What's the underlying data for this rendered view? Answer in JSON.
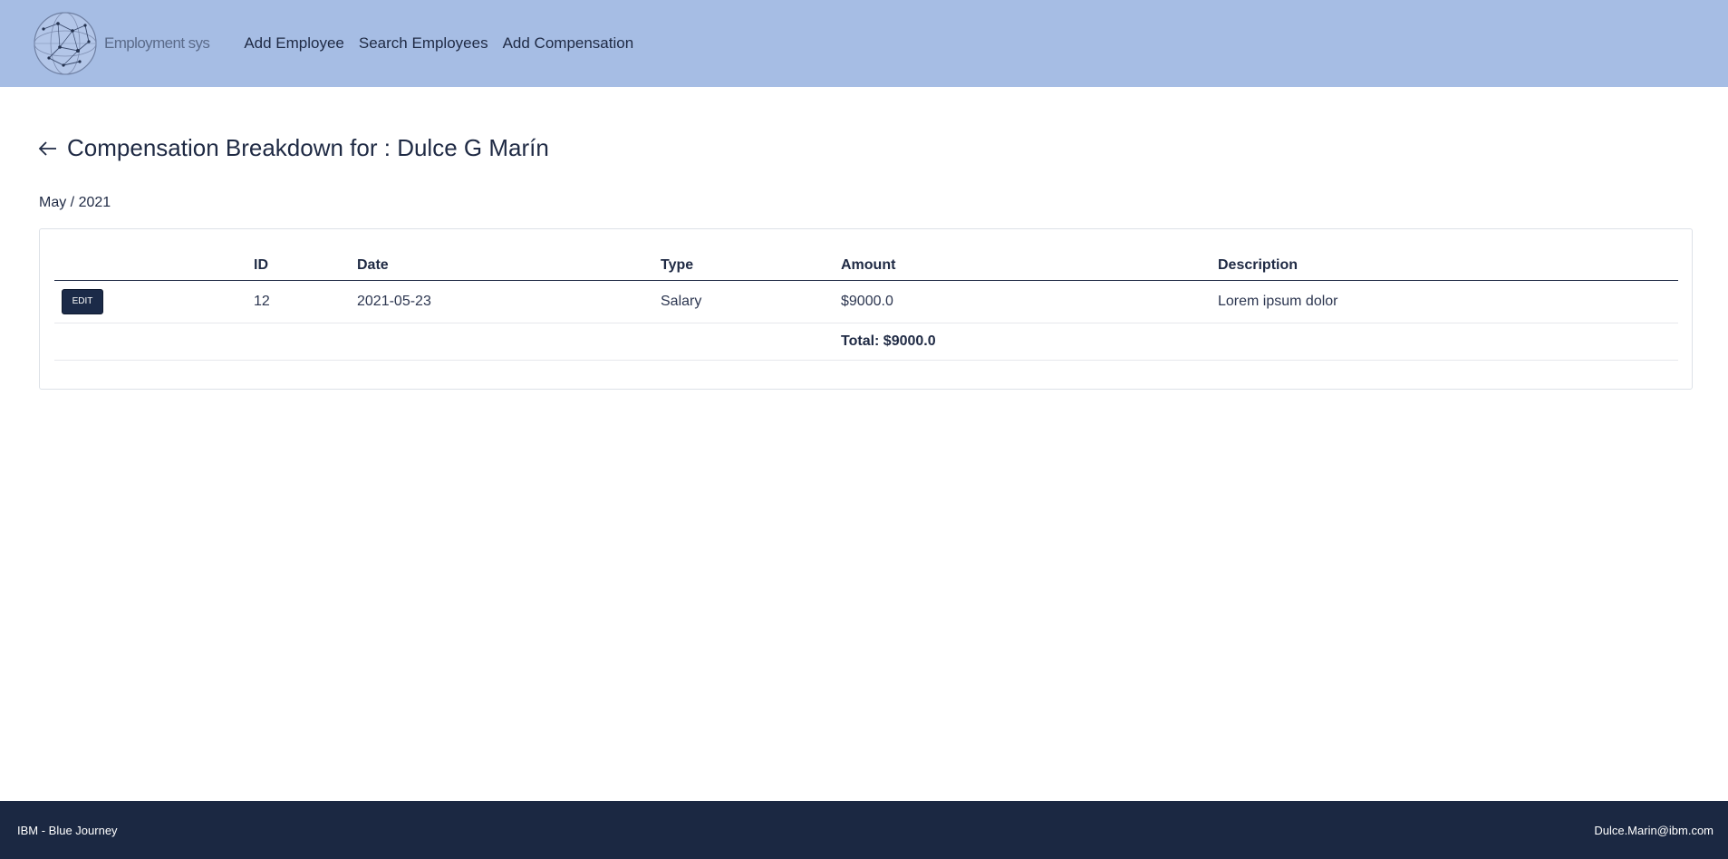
{
  "app": {
    "logo_text": "Employment sys"
  },
  "nav": {
    "items": [
      {
        "label": "Add Employee"
      },
      {
        "label": "Search Employees"
      },
      {
        "label": "Add Compensation"
      }
    ]
  },
  "page": {
    "title": "Compensation Breakdown for : Dulce G Marín",
    "period": "May / 2021"
  },
  "table": {
    "headers": {
      "edit": "",
      "id": "ID",
      "date": "Date",
      "type": "Type",
      "amount": "Amount",
      "description": "Description"
    },
    "rows": [
      {
        "edit_label": "EDIT",
        "id": "12",
        "date": "2021-05-23",
        "type": "Salary",
        "amount": "$9000.0",
        "description": "Lorem ipsum dolor"
      }
    ],
    "total": "Total: $9000.0"
  },
  "footer": {
    "left": "IBM - Blue Journey",
    "right": "Dulce.Marin@ibm.com"
  },
  "colors": {
    "header_bg": "#a6bde4",
    "footer_bg": "#1b2842",
    "button_bg": "#1b2a48",
    "text": "#1f2a44"
  },
  "icons": {
    "logo": "globe-network-icon",
    "back": "arrow-left-icon"
  }
}
